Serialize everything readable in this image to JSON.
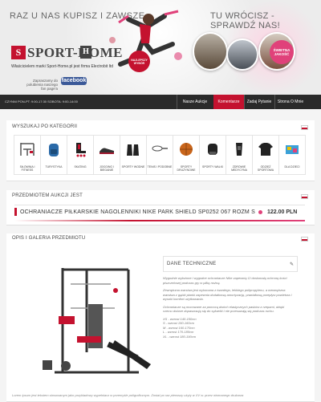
{
  "header": {
    "slogan_left": "RAZ U NAS KUPISZ I ZAWSZE",
    "slogan_right": "TU WRÓCISZ - SPRAWDŹ NAS!",
    "logo_letter": "S",
    "logo_name": "SPORT-HOME",
    "logo_badge": "H",
    "owner_text": "Właścicielem marki Sport-Home.pl jest firma Electrobit ltd",
    "facebook_text": "Zapraszamy do polubienia naszego fan page'a",
    "facebook_label": "facebook",
    "badge_red": "NAJLEPSZY WYBÓR",
    "badge_pink": "ŚWIETNA JAKOŚĆ"
  },
  "nav": {
    "hours": "CZYNNI  PON-PT: 9:00-17:30  SOBOTA: 9:00-14:00",
    "items": [
      "Nasze Aukcje",
      "Komentarze",
      "Zadaj Pytanie",
      "Strona O Mnie"
    ]
  },
  "categories": {
    "title": "WYSZUKAJ PO KATEGORII",
    "items": [
      {
        "label": "SIŁOWNIA I FITNESS",
        "icon": "gym-machine-icon"
      },
      {
        "label": "TURYSTYKA",
        "icon": "backpack-icon"
      },
      {
        "label": "SKATING",
        "icon": "skate-icon"
      },
      {
        "label": "JOGGING I BIEGANIE",
        "icon": "running-shoe-icon"
      },
      {
        "label": "SPORTY WODNE",
        "icon": "fins-icon"
      },
      {
        "label": "TENIS I PODOBNE",
        "icon": "racket-icon"
      },
      {
        "label": "SPORTY DRUŻYNOWE",
        "icon": "basketball-icon"
      },
      {
        "label": "SPORTY WALKI",
        "icon": "gloves-icon"
      },
      {
        "label": "ZDROWIE MEDYCYNA",
        "icon": "brace-icon"
      },
      {
        "label": "ODZIEŻ SPORTOWA",
        "icon": "shirt-icon"
      },
      {
        "label": "DLA DZIECI",
        "icon": "toy-icon"
      }
    ]
  },
  "auction": {
    "title": "PRZEDMIOTEM AUKCJI JEST",
    "product_name": "OCHRANIACZE PIŁKARSKIE NAGOLENNIKI NIKE PARK SHIELD SP0252 067 ROZM S",
    "price": "122.00 PLN"
  },
  "description": {
    "title": "OPIS I GALERIA PRZEDMIOTU",
    "tech_title": "DANE TECHNICZNE",
    "paragraphs": [
      "Wygodnie wyłożone i wygodne ochraniacze Nike zapewnią Ci doskonałą ochronę kości piszczelowej podczas gry w piłkę nożną.",
      "Zewnętrzna warstwa jest wykonana z twardego, lekkiego polipropylenu, a wewnętrzna warstwa z gąbki pianki zapewnia dodatkową amortyzację, prawidłową przepływ powietrza i wysoki komfort użytkowania.",
      "Ochraniacze są mocowane za pomocą dwóch elastycznych pasków z rzepami, dzięki czemu dobrze dopasowują się do sylwetki i nie przesuwają się podczas ruchu.",
      "XS - wzrost 140-150cm\nS - wzrost 150-160cm\nM - wzrost 160-170cm\nL - wzrost 170-180cm\nXL - wzrost 180-190cm"
    ],
    "bottom": "Lorem ipsum jest tekstem stosowanym jako przykładowy wypełniacz w przemyśle poligraficznym. Został po raz pierwszy użyty w XV w. przez nieznanego drukarza"
  },
  "colors": {
    "accent": "#c4122f",
    "pink": "#e0417a",
    "nav": "#2a2a2a"
  }
}
